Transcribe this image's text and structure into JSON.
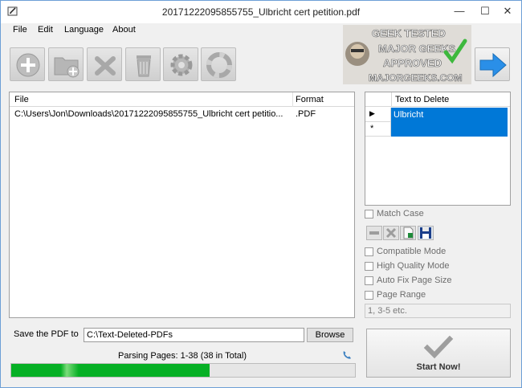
{
  "window": {
    "title": "20171222095855755_Ulbricht cert petition.pdf",
    "minimize": "—",
    "maximize": "☐",
    "close": "✕"
  },
  "menu": [
    "File",
    "Edit",
    "Language",
    "About"
  ],
  "toolbar": {
    "buttons": [
      "add-file-icon",
      "add-folder-icon",
      "remove-icon",
      "trash-icon",
      "settings-icon",
      "help-icon"
    ]
  },
  "badge": {
    "line1": "GEEK TESTED",
    "line2": "MAJOR GEEKS",
    "line3": "APPROVED",
    "line4": "MAJORGEEKS.COM"
  },
  "file_table": {
    "columns": [
      "File",
      "Format"
    ],
    "rows": [
      {
        "file": "C:\\Users\\Jon\\Downloads\\20171222095855755_Ulbricht cert petitio...",
        "format": ".PDF"
      }
    ]
  },
  "delete_table": {
    "header": "Text to Delete",
    "rows": [
      "Ulbricht",
      ""
    ],
    "row_markers": [
      "▶",
      "*"
    ]
  },
  "options": {
    "match_case": "Match Case",
    "compatible_mode": "Compatible Mode",
    "high_quality_mode": "High Quality Mode",
    "auto_fix_page_size": "Auto Fix Page Size",
    "page_range": "Page Range",
    "page_range_placeholder": "1, 3-5 etc."
  },
  "save": {
    "label": "Save the PDF to",
    "path": "C:\\Text-Deleted-PDFs",
    "browse": "Browse"
  },
  "status": {
    "text": "Parsing Pages: 1-38 (38 in Total)",
    "progress": 0.577
  },
  "start": {
    "label": "Start Now!"
  },
  "colors": {
    "selection": "#0078d7",
    "progress": "#06b025",
    "accent_blue": "#2a8fe8"
  }
}
